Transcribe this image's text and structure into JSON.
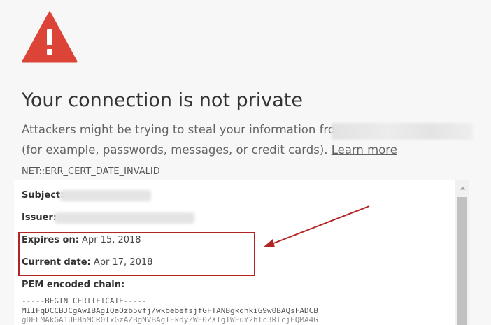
{
  "interstitial": {
    "title": "Your connection is not private",
    "description_line1": "Attackers might be trying to steal your information from",
    "description_line2": "(for example, passwords, messages, or credit cards).",
    "learn_more_label": "Learn more",
    "error_code": "NET::ERR_CERT_DATE_INVALID",
    "warning_icon": "warning-triangle-icon",
    "accent_color": "#db4437"
  },
  "certificate": {
    "subject_label": "Subject:",
    "issuer_label": "Issuer:",
    "expires_label": "Expires on:",
    "expires_value": "Apr 15, 2018",
    "current_label": "Current date:",
    "current_value": "Apr 17, 2018",
    "pem_label": "PEM encoded chain:",
    "pem_lines": [
      "-----BEGIN CERTIFICATE-----",
      "MIIFqDCCBJCgAwIBAgIQaOzb5vfj/wkbebefsjfGFTANBgkqhkiG9w0BAQsFADCB",
      "gDELMAkGA1UEBhMCR0IxGzAZBgNVBAgTEkdyZWF0ZXIgTWFuY2hlc3RlcjEQMA4G"
    ]
  },
  "annotation": {
    "highlight_color": "#b32424"
  }
}
